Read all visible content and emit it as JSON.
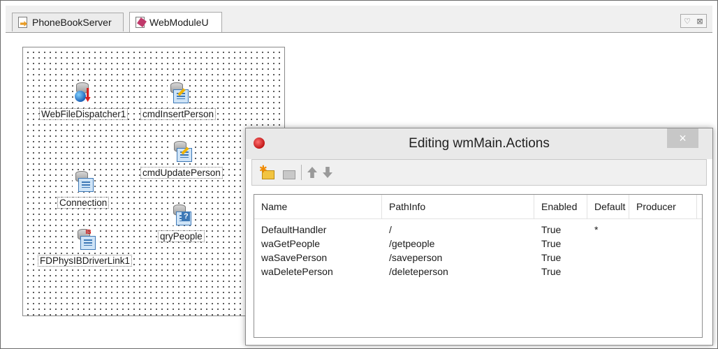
{
  "tabs": [
    {
      "label": "PhoneBookServer",
      "active": false
    },
    {
      "label": "WebModuleU",
      "active": true
    }
  ],
  "designer": {
    "components": [
      {
        "name": "WebFileDispatcher1",
        "icon": "web-file-dispatcher-icon"
      },
      {
        "name": "cmdInsertPerson",
        "icon": "fdcommand-icon"
      },
      {
        "name": "cmdUpdatePerson",
        "icon": "fdcommand-icon"
      },
      {
        "name": "Connection",
        "icon": "fdconnection-icon"
      },
      {
        "name": "qryPeople",
        "icon": "fdquery-icon"
      },
      {
        "name": "FDPhysIBDriverLink1",
        "icon": "ib-driver-link-icon"
      }
    ]
  },
  "dialog": {
    "title": "Editing wmMain.Actions",
    "close_glyph": "×",
    "columns": [
      "Name",
      "PathInfo",
      "Enabled",
      "Default",
      "Producer"
    ],
    "rows": [
      {
        "name": "DefaultHandler",
        "path": "/",
        "enabled": "True",
        "default": "*",
        "producer": ""
      },
      {
        "name": "waGetPeople",
        "path": "/getpeople",
        "enabled": "True",
        "default": "",
        "producer": ""
      },
      {
        "name": "waSavePerson",
        "path": "/saveperson",
        "enabled": "True",
        "default": "",
        "producer": ""
      },
      {
        "name": "waDeletePerson",
        "path": "/deleteperson",
        "enabled": "True",
        "default": "",
        "producer": ""
      }
    ]
  },
  "window_buttons": {
    "restore": "♡",
    "close": "⊠"
  }
}
